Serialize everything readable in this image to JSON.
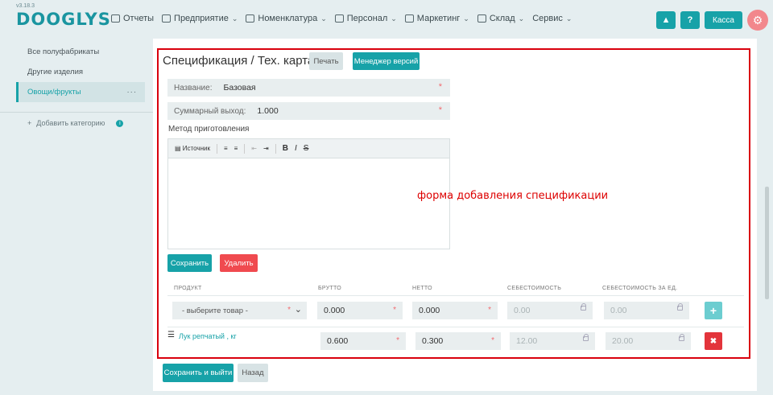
{
  "app": {
    "version": "v3.18.3",
    "logo": "DOOGLYS"
  },
  "nav": {
    "items": [
      {
        "label": "Отчеты",
        "has_chevron": false
      },
      {
        "label": "Предприятие",
        "has_chevron": true
      },
      {
        "label": "Номенклатура",
        "has_chevron": true
      },
      {
        "label": "Персонал",
        "has_chevron": true
      },
      {
        "label": "Маркетинг",
        "has_chevron": true
      },
      {
        "label": "Склад",
        "has_chevron": true
      },
      {
        "label": "Сервис",
        "has_chevron": true
      }
    ],
    "kassa_label": "Касса",
    "help_label": "?"
  },
  "sidebar": {
    "items": [
      {
        "label": "Все полуфабрикаты"
      },
      {
        "label": "Другие изделия"
      },
      {
        "label": "Овощи/фрукты",
        "more": "···"
      }
    ],
    "add_category": "Добавить категорию"
  },
  "spec": {
    "title": "Спецификация / Тех. карта",
    "print_label": "Печать",
    "version_manager_label": "Менеджер версий",
    "name_label": "Название:",
    "name_value": "Базовая",
    "yield_label": "Суммарный выход:",
    "yield_value": "1.000",
    "method_label": "Метод приготовления",
    "editor": {
      "source": "Источник",
      "bold": "B",
      "italic": "I",
      "strike": "S"
    },
    "save_label": "Сохранить",
    "delete_label": "Удалить",
    "annotation": "форма добавления спецификации"
  },
  "table": {
    "headers": [
      "ПРОДУКТ",
      "БРУТТО",
      "НЕТТО",
      "СЕБЕСТОИМОСТЬ",
      "СЕБЕСТОИМОСТЬ ЗА ЕД."
    ],
    "new_row": {
      "product_placeholder": "- выберите товар -",
      "brutto": "0.000",
      "netto": "0.000",
      "cost": "0.00",
      "unit_cost": "0.00"
    },
    "rows": [
      {
        "product": "Лук репчатый , кг",
        "brutto": "0.600",
        "netto": "0.300",
        "cost": "12.00",
        "unit_cost": "20.00"
      }
    ]
  },
  "footer": {
    "save_exit_label": "Сохранить и выйти",
    "back_label": "Назад"
  },
  "colors": {
    "accent": "#17a2a8",
    "danger": "#f04a4f",
    "annotation": "#d9000d"
  }
}
